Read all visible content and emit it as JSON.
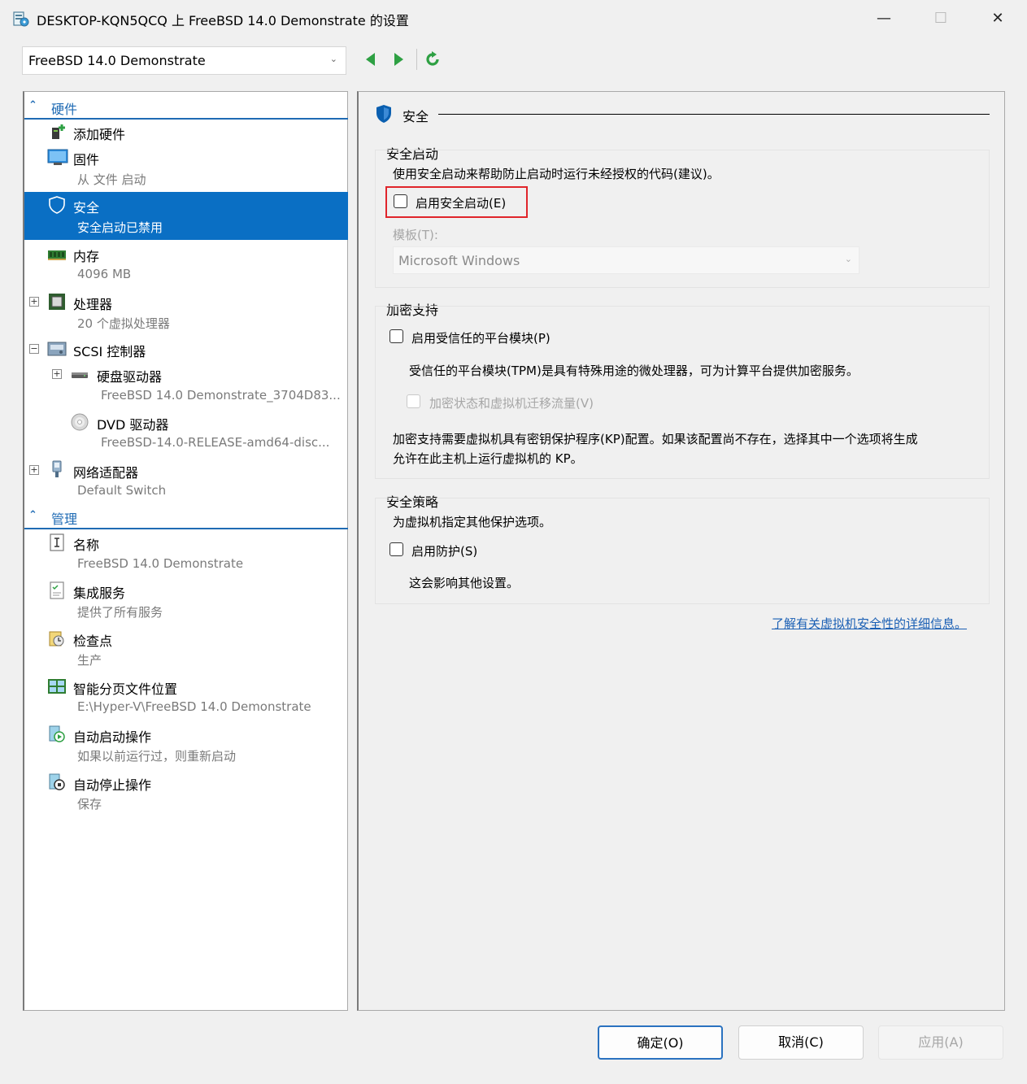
{
  "window": {
    "title": "DESKTOP-KQN5QCQ 上 FreeBSD 14.0 Demonstrate 的设置",
    "minimize": "—",
    "maximize": "☐",
    "close": "✕"
  },
  "toolbar": {
    "vm_name": "FreeBSD 14.0 Demonstrate"
  },
  "tree": {
    "hardware_label": "硬件",
    "management_label": "管理",
    "hardware_items": [
      {
        "name": "添加硬件",
        "sub": ""
      },
      {
        "name": "固件",
        "sub": "从 文件 启动"
      },
      {
        "name": "安全",
        "sub": "安全启动已禁用"
      },
      {
        "name": "内存",
        "sub": "4096 MB"
      },
      {
        "name": "处理器",
        "sub": "20 个虚拟处理器"
      },
      {
        "name": "SCSI 控制器",
        "sub": ""
      },
      {
        "name": "硬盘驱动器",
        "sub": "FreeBSD 14.0 Demonstrate_3704D83..."
      },
      {
        "name": "DVD 驱动器",
        "sub": "FreeBSD-14.0-RELEASE-amd64-disc..."
      },
      {
        "name": "网络适配器",
        "sub": "Default Switch"
      }
    ],
    "management_items": [
      {
        "name": "名称",
        "sub": "FreeBSD 14.0 Demonstrate"
      },
      {
        "name": "集成服务",
        "sub": "提供了所有服务"
      },
      {
        "name": "检查点",
        "sub": "生产"
      },
      {
        "name": "智能分页文件位置",
        "sub": "E:\\Hyper-V\\FreeBSD 14.0 Demonstrate"
      },
      {
        "name": "自动启动操作",
        "sub": "如果以前运行过，则重新启动"
      },
      {
        "name": "自动停止操作",
        "sub": "保存"
      }
    ]
  },
  "details": {
    "title": "安全",
    "secure_boot": {
      "label": "安全启动",
      "desc": "使用安全启动来帮助防止启动时运行未经授权的代码(建议)。",
      "checkbox": "启用安全启动(E)",
      "checked": false,
      "template_label": "模板(T):",
      "template_value": "Microsoft Windows"
    },
    "encryption": {
      "label": "加密支持",
      "tpm_checkbox": "启用受信任的平台模块(P)",
      "tpm_checked": false,
      "tpm_desc": "受信任的平台模块(TPM)是具有特殊用途的微处理器，可为计算平台提供加密服务。",
      "migrate_checkbox": "加密状态和虚拟机迁移流量(V)",
      "kp_desc_line1": "加密支持需要虚拟机具有密钥保护程序(KP)配置。如果该配置尚不存在，选择其中一个选项将生成",
      "kp_desc_line2": "允许在此主机上运行虚拟机的 KP。"
    },
    "policy": {
      "label": "安全策略",
      "desc": "为虚拟机指定其他保护选项。",
      "shield_checkbox": "启用防护(S)",
      "shield_checked": false,
      "note": "这会影响其他设置。"
    },
    "learn_more": "了解有关虚拟机安全性的详细信息。"
  },
  "buttons": {
    "ok": "确定(O)",
    "cancel": "取消(C)",
    "apply": "应用(A)"
  }
}
